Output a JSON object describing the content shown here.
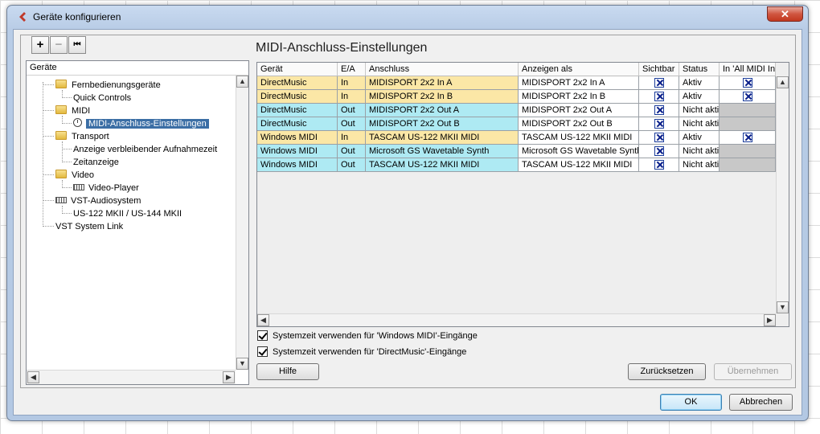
{
  "window": {
    "title": "Geräte konfigurieren",
    "close_glyph": "✕"
  },
  "toolbar": {
    "add": "+",
    "remove": "−",
    "reset": "⏮"
  },
  "tree": {
    "header": "Geräte",
    "nodes": [
      {
        "label": "Fernbedienungsgeräte",
        "icon": "folder-icon"
      },
      {
        "label": "Quick Controls"
      },
      {
        "label": "MIDI",
        "icon": "folder-icon"
      },
      {
        "label": "MIDI-Anschluss-Einstellungen",
        "icon": "clock-icon",
        "selected": true
      },
      {
        "label": "Transport",
        "icon": "folder-icon"
      },
      {
        "label": "Anzeige verbleibender Aufnahmezeit"
      },
      {
        "label": "Zeitanzeige"
      },
      {
        "label": "Video",
        "icon": "folder-icon"
      },
      {
        "label": "Video-Player",
        "icon": "video-icon"
      },
      {
        "label": "VST-Audiosystem",
        "icon": "audio-icon"
      },
      {
        "label": "US-122 MKII / US-144 MKII"
      },
      {
        "label": "VST System Link"
      }
    ]
  },
  "panel": {
    "title": "MIDI-Anschluss-Einstellungen",
    "columns": [
      "Gerät",
      "E/A",
      "Anschluss",
      "Anzeigen als",
      "Sichtbar",
      "Status",
      "In 'All MIDI In"
    ],
    "rows": [
      {
        "device": "DirectMusic",
        "io": "In",
        "port": "MIDISPORT 2x2 In A",
        "show_as": "MIDISPORT 2x2 In A",
        "visible": true,
        "status": "Aktiv",
        "all_midi": true,
        "color": "#fbe7a6"
      },
      {
        "device": "DirectMusic",
        "io": "In",
        "port": "MIDISPORT 2x2 In B",
        "show_as": "MIDISPORT 2x2 In B",
        "visible": true,
        "status": "Aktiv",
        "all_midi": true,
        "color": "#fbe7a6"
      },
      {
        "device": "DirectMusic",
        "io": "Out",
        "port": "MIDISPORT 2x2 Out A",
        "show_as": "MIDISPORT 2x2 Out A",
        "visible": true,
        "status": "Nicht akti",
        "all_midi": null,
        "color": "#aeeaf3"
      },
      {
        "device": "DirectMusic",
        "io": "Out",
        "port": "MIDISPORT 2x2 Out B",
        "show_as": "MIDISPORT 2x2 Out B",
        "visible": true,
        "status": "Nicht akti",
        "all_midi": null,
        "color": "#aeeaf3"
      },
      {
        "device": "Windows MIDI",
        "io": "In",
        "port": "TASCAM US-122 MKII MIDI",
        "show_as": "TASCAM US-122 MKII MIDI",
        "visible": true,
        "status": "Aktiv",
        "all_midi": true,
        "color": "#fbe7a6"
      },
      {
        "device": "Windows MIDI",
        "io": "Out",
        "port": "Microsoft GS Wavetable Synth",
        "show_as": "Microsoft GS Wavetable Synth",
        "visible": true,
        "status": "Nicht akti",
        "all_midi": null,
        "color": "#aeeaf3"
      },
      {
        "device": "Windows MIDI",
        "io": "Out",
        "port": "TASCAM US-122 MKII MIDI",
        "show_as": "TASCAM US-122 MKII MIDI",
        "visible": true,
        "status": "Nicht akti",
        "all_midi": null,
        "color": "#aeeaf3"
      }
    ],
    "disabled_cell_color": "#c8c8c8",
    "options": [
      {
        "label": "Systemzeit verwenden für 'Windows MIDI'-Eingänge",
        "checked": true
      },
      {
        "label": "Systemzeit verwenden für 'DirectMusic'-Eingänge",
        "checked": true
      }
    ]
  },
  "buttons": {
    "help": "Hilfe",
    "reset": "Zurücksetzen",
    "apply": "Übernehmen",
    "ok": "OK",
    "cancel": "Abbrechen"
  },
  "scroll": {
    "up": "▲",
    "down": "▼",
    "left": "◀",
    "right": "▶"
  }
}
